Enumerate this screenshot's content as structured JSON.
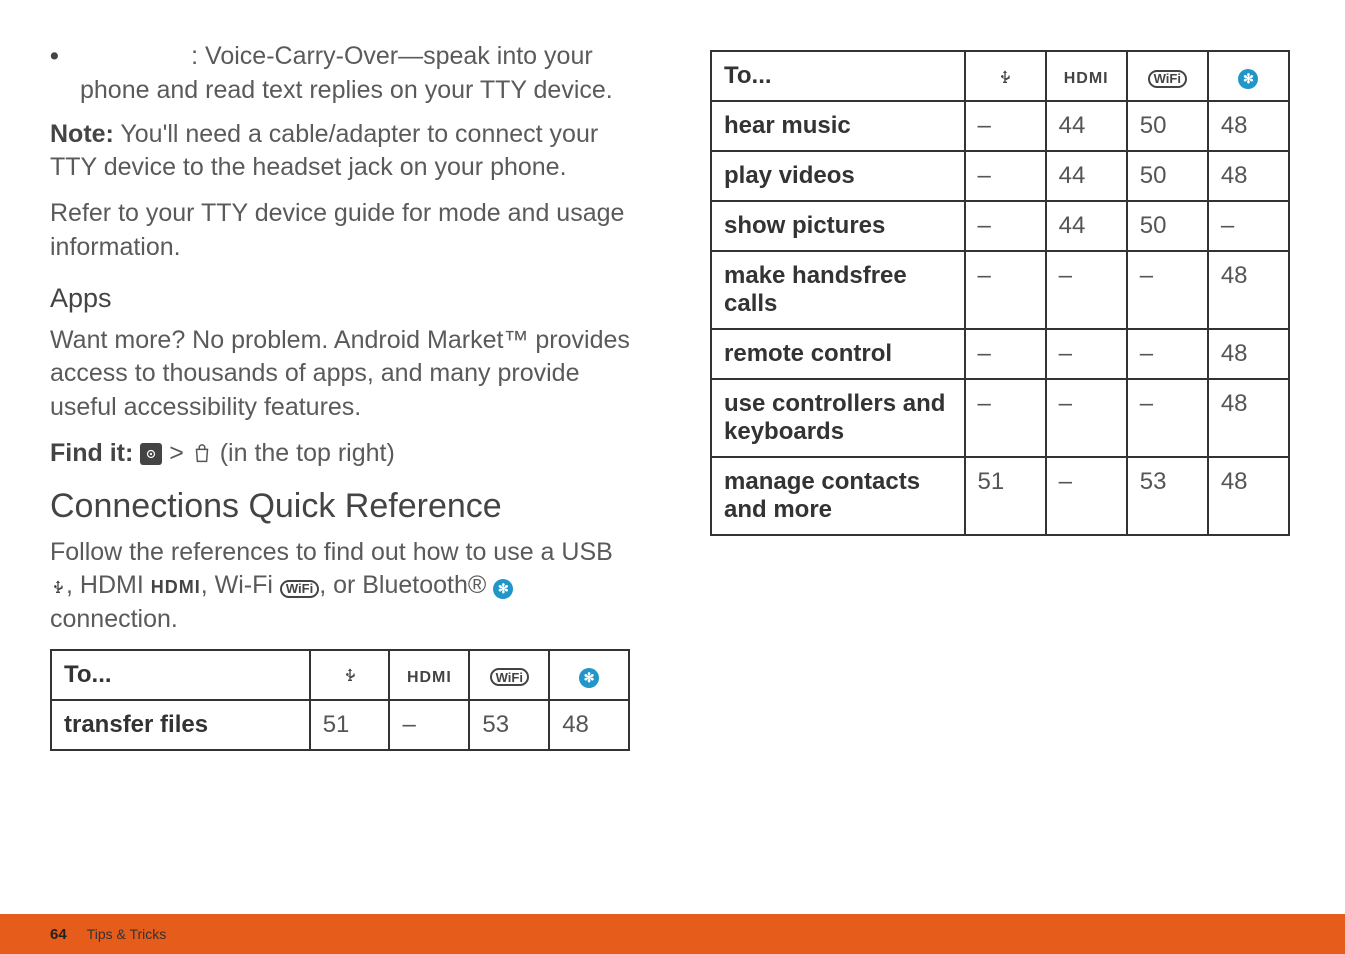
{
  "left": {
    "bullet": {
      "lead": ": Voice-Carry-Over—speak into your phone and read text replies on your TTY device."
    },
    "note_label": "Note:",
    "note_text": " You'll need a cable/adapter to connect your TTY device to the headset jack on your phone.",
    "refer": "Refer to your TTY device guide for mode and usage information.",
    "apps_heading": "Apps",
    "apps_body": "Want more? No problem. Android Market™ provides access to thousands of apps, and many provide useful accessibility features.",
    "findit_label": "Find it:",
    "findit_tail": " (in the top right)",
    "conn_heading": "Connections Quick Reference",
    "conn_body1": "Follow the references to find out how to use a USB ",
    "conn_body2": ", HDMI ",
    "conn_body3": ", Wi-Fi ",
    "conn_body4": ", or Bluetooth® ",
    "conn_body5": " connection."
  },
  "icons": {
    "usb": "usb-icon",
    "hdmi_label": "HDMI",
    "wifi_label": "WiFi",
    "bt_glyph": "✻"
  },
  "table_header": {
    "to": "To..."
  },
  "chart_data": [
    {
      "type": "table",
      "title": "Connections Quick Reference (left column)",
      "columns": [
        "To...",
        "USB",
        "HDMI",
        "WiFi",
        "Bluetooth"
      ],
      "rows": [
        {
          "to": "transfer files",
          "usb": "51",
          "hdmi": "–",
          "wifi": "53",
          "bt": "48"
        }
      ]
    },
    {
      "type": "table",
      "title": "Connections Quick Reference (right column)",
      "columns": [
        "To...",
        "USB",
        "HDMI",
        "WiFi",
        "Bluetooth"
      ],
      "rows": [
        {
          "to": "hear music",
          "usb": "–",
          "hdmi": "44",
          "wifi": "50",
          "bt": "48"
        },
        {
          "to": "play videos",
          "usb": "–",
          "hdmi": "44",
          "wifi": "50",
          "bt": "48"
        },
        {
          "to": "show pictures",
          "usb": "–",
          "hdmi": "44",
          "wifi": "50",
          "bt": "–"
        },
        {
          "to": "make handsfree calls",
          "usb": "–",
          "hdmi": "–",
          "wifi": "–",
          "bt": "48"
        },
        {
          "to": "remote control",
          "usb": "–",
          "hdmi": "–",
          "wifi": "–",
          "bt": "48"
        },
        {
          "to": "use controllers and keyboards",
          "usb": "–",
          "hdmi": "–",
          "wifi": "–",
          "bt": "48"
        },
        {
          "to": "manage contacts and more",
          "usb": "51",
          "hdmi": "–",
          "wifi": "53",
          "bt": "48"
        }
      ]
    }
  ],
  "footer": {
    "page": "64",
    "section": "Tips & Tricks"
  }
}
